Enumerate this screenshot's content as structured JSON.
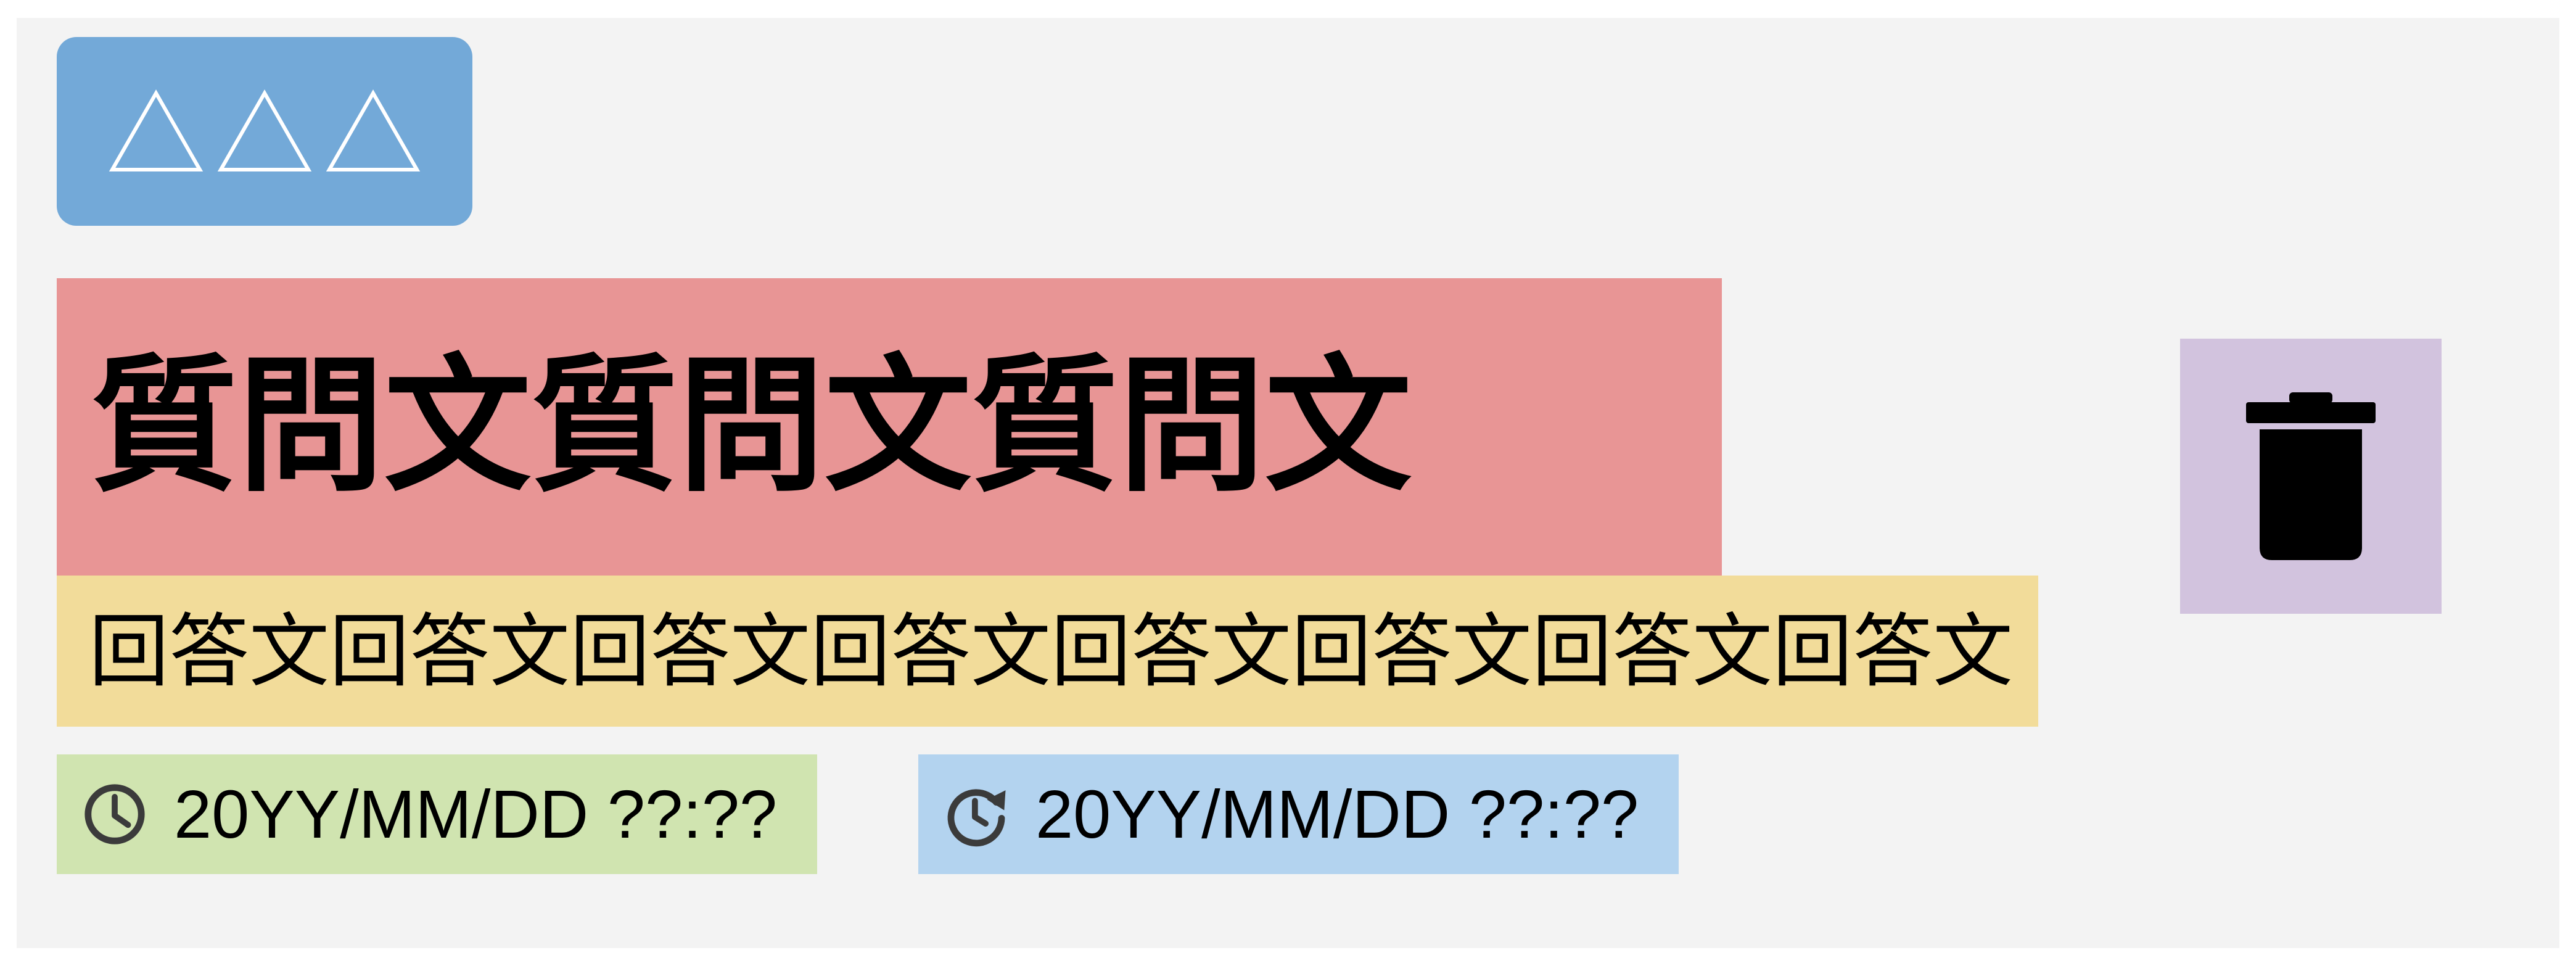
{
  "card": {
    "tag": {
      "icons": [
        "triangle-icon",
        "triangle-icon",
        "triangle-icon"
      ]
    },
    "question": "質問文質問文質問文",
    "answer": "回答文回答文回答文回答文回答文回答文回答文回答文",
    "created": {
      "icon": "clock-icon",
      "text": "20YY/MM/DD ??:??"
    },
    "updated": {
      "icon": "history-icon",
      "text": "20YY/MM/DD ??:??"
    },
    "delete": {
      "icon": "trash-icon"
    }
  },
  "colors": {
    "card_background": "#f3f3f3",
    "tag": "#73a9d8",
    "question": "#e89595",
    "answer": "#f2dc9a",
    "created": "#d0e4b0",
    "updated": "#b3d3ef",
    "delete": "#d2c3de"
  }
}
